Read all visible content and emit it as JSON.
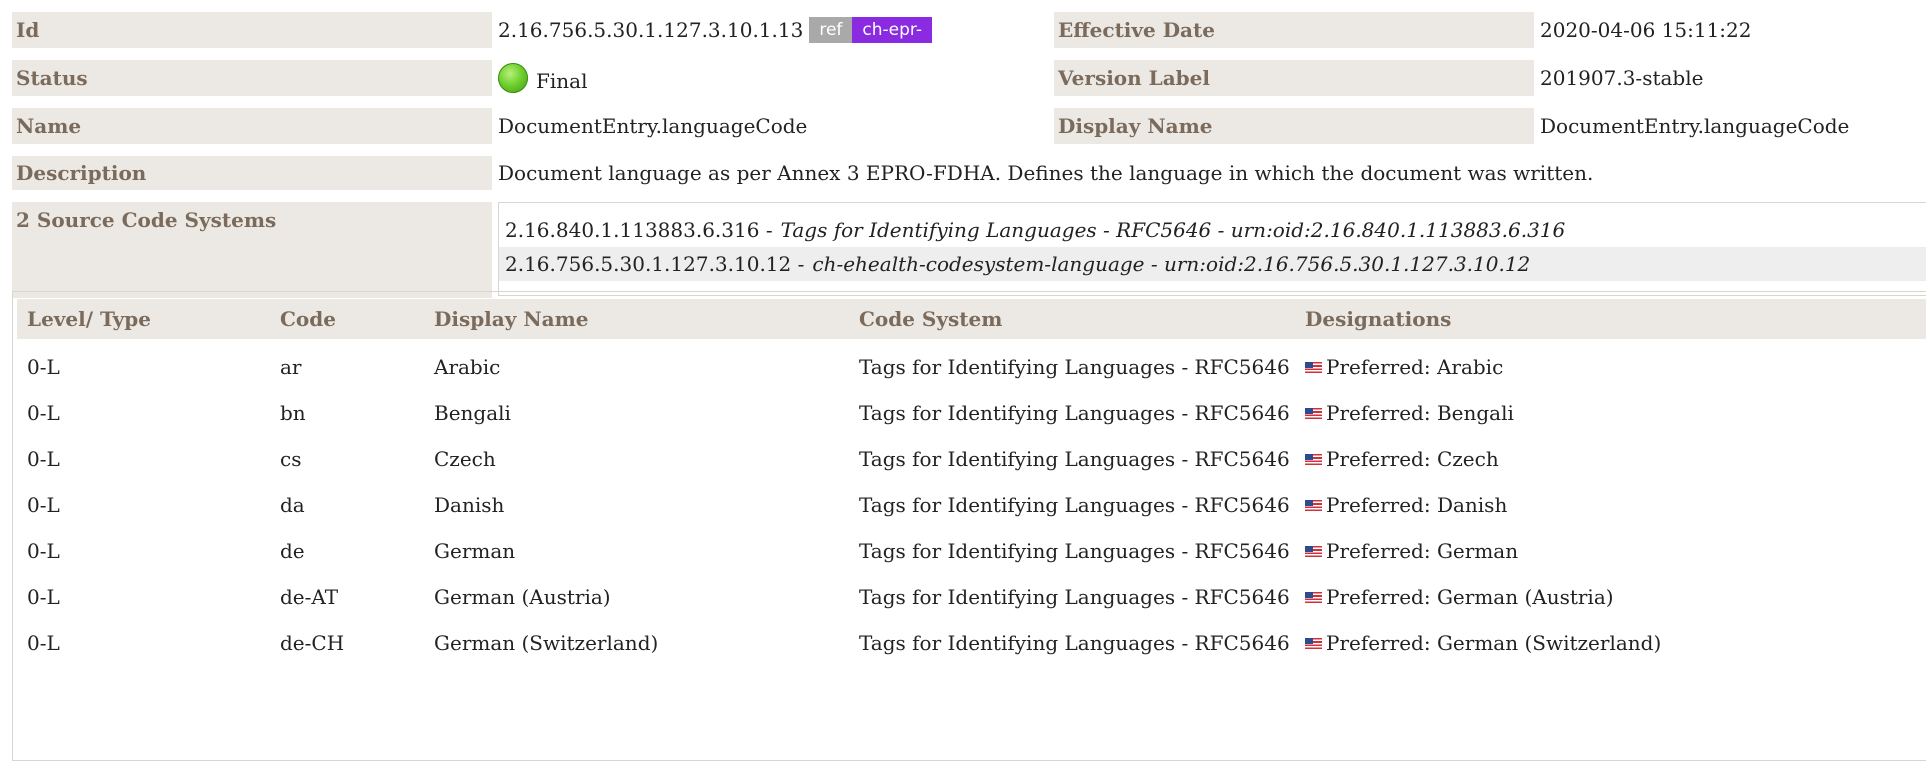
{
  "meta": {
    "id_label": "Id",
    "id_value": "2.16.756.5.30.1.127.3.10.1.13",
    "ref_badge": "ref",
    "prefix_badge": "ch-epr-",
    "effective_date_label": "Effective Date",
    "effective_date_value": "2020-04-06 15:11:22",
    "status_label": "Status",
    "status_value": "Final",
    "version_label_label": "Version Label",
    "version_label_value": "201907.3-stable",
    "name_label": "Name",
    "name_value": "DocumentEntry.languageCode",
    "display_name_label": "Display Name",
    "display_name_value": "DocumentEntry.languageCode",
    "description_label": "Description",
    "description_value": "Document language as per Annex 3 EPRO-FDHA. Defines the language in which the document was written.",
    "source_label": "2 Source Code Systems",
    "sources": [
      {
        "oid": "2.16.840.1.113883.6.316 -",
        "name": "Tags for Identifying Languages - RFC5646 - urn:oid:2.16.840.1.113883.6.316"
      },
      {
        "oid": "2.16.756.5.30.1.127.3.10.12 -",
        "name": "ch-ehealth-codesystem-language - urn:oid:2.16.756.5.30.1.127.3.10.12"
      }
    ]
  },
  "table": {
    "headers": [
      "Level/ Type",
      "Code",
      "Display Name",
      "Code System",
      "Designations"
    ],
    "rows": [
      {
        "level": "0-L",
        "code": "ar",
        "display": "Arabic",
        "system": "Tags for Identifying Languages - RFC5646",
        "designation": "Preferred: Arabic"
      },
      {
        "level": "0-L",
        "code": "bn",
        "display": "Bengali",
        "system": "Tags for Identifying Languages - RFC5646",
        "designation": "Preferred: Bengali"
      },
      {
        "level": "0-L",
        "code": "cs",
        "display": "Czech",
        "system": "Tags for Identifying Languages - RFC5646",
        "designation": "Preferred: Czech"
      },
      {
        "level": "0-L",
        "code": "da",
        "display": "Danish",
        "system": "Tags for Identifying Languages - RFC5646",
        "designation": "Preferred: Danish"
      },
      {
        "level": "0-L",
        "code": "de",
        "display": "German",
        "system": "Tags for Identifying Languages - RFC5646",
        "designation": "Preferred: German"
      },
      {
        "level": "0-L",
        "code": "de-AT",
        "display": "German (Austria)",
        "system": "Tags for Identifying Languages - RFC5646",
        "designation": "Preferred: German (Austria)"
      },
      {
        "level": "0-L",
        "code": "de-CH",
        "display": "German (Switzerland)",
        "system": "Tags for Identifying Languages - RFC5646",
        "designation": "Preferred: German (Switzerland)"
      }
    ]
  },
  "icons": {
    "status": "status-final-green-ball-icon",
    "flag": "us-flag-icon"
  },
  "colors": {
    "label_bg": "#ece9e4",
    "label_text": "#7b6b5c",
    "prefix_badge": "#8a2be2",
    "ref_badge": "#a9a9a9"
  }
}
